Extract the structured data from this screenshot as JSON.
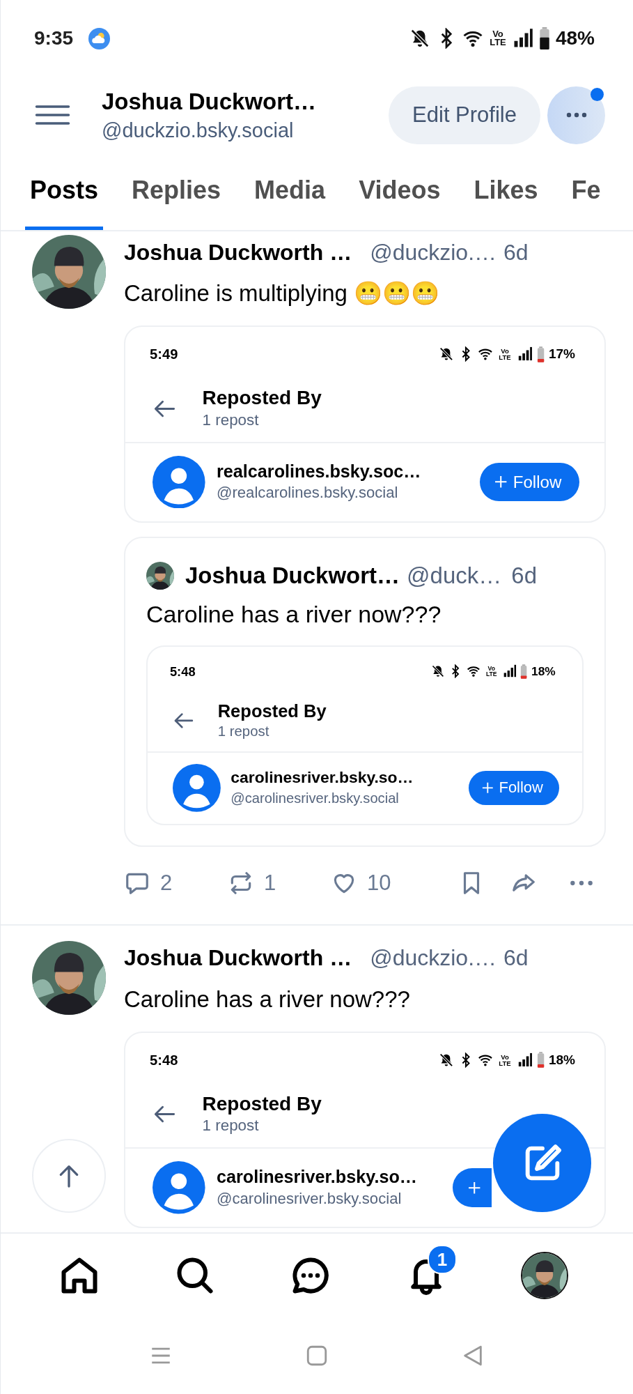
{
  "status_bar": {
    "time": "9:35",
    "network": "Vo LTE",
    "battery": "48%"
  },
  "header": {
    "name": "Joshua Duckwort…",
    "handle": "@duckzio.bsky.social",
    "edit_button": "Edit Profile",
    "more_notification": true
  },
  "tabs": [
    {
      "label": "Posts",
      "selected": true
    },
    {
      "label": "Replies",
      "selected": false
    },
    {
      "label": "Media",
      "selected": false
    },
    {
      "label": "Videos",
      "selected": false
    },
    {
      "label": "Likes",
      "selected": false
    },
    {
      "label": "Fe",
      "selected": false
    }
  ],
  "posts": [
    {
      "author": "Joshua Duckworth …",
      "handle": "@duckzio.…",
      "time": "6d",
      "text": "Caroline is multiplying 😬😬😬",
      "embed": {
        "kind": "screenshot",
        "time": "5:49",
        "network": "Vo LTE",
        "battery": "17%",
        "title": "Reposted By",
        "subtitle": "1 repost",
        "user_name": "realcarolines.bsky.soc…",
        "user_handle": "@realcarolines.bsky.social",
        "follow_label": "Follow"
      },
      "quote": {
        "author": "Joshua Duckwort…",
        "handle": "@duck…",
        "time": "6d",
        "text": "Caroline has a river now???",
        "embed": {
          "kind": "screenshot",
          "time": "5:48",
          "network": "Vo LTE",
          "battery": "18%",
          "title": "Reposted By",
          "subtitle": "1 repost",
          "user_name": "carolinesriver.bsky.so…",
          "user_handle": "@carolinesriver.bsky.social",
          "follow_label": "Follow"
        }
      },
      "actions": {
        "replies": "2",
        "reposts": "1",
        "likes": "10"
      }
    },
    {
      "author": "Joshua Duckworth …",
      "handle": "@duckzio.…",
      "time": "6d",
      "text": "Caroline has a river now???",
      "embed": {
        "kind": "screenshot",
        "time": "5:48",
        "network": "Vo LTE",
        "battery": "18%",
        "title": "Reposted By",
        "subtitle": "1 repost",
        "user_name": "carolinesriver.bsky.so…",
        "user_handle": "@carolinesriver.bsky.social"
      }
    }
  ],
  "nav": [
    {
      "kind": "home"
    },
    {
      "kind": "search"
    },
    {
      "kind": "chat"
    },
    {
      "kind": "notifications",
      "badge": "1"
    },
    {
      "kind": "profile"
    }
  ]
}
